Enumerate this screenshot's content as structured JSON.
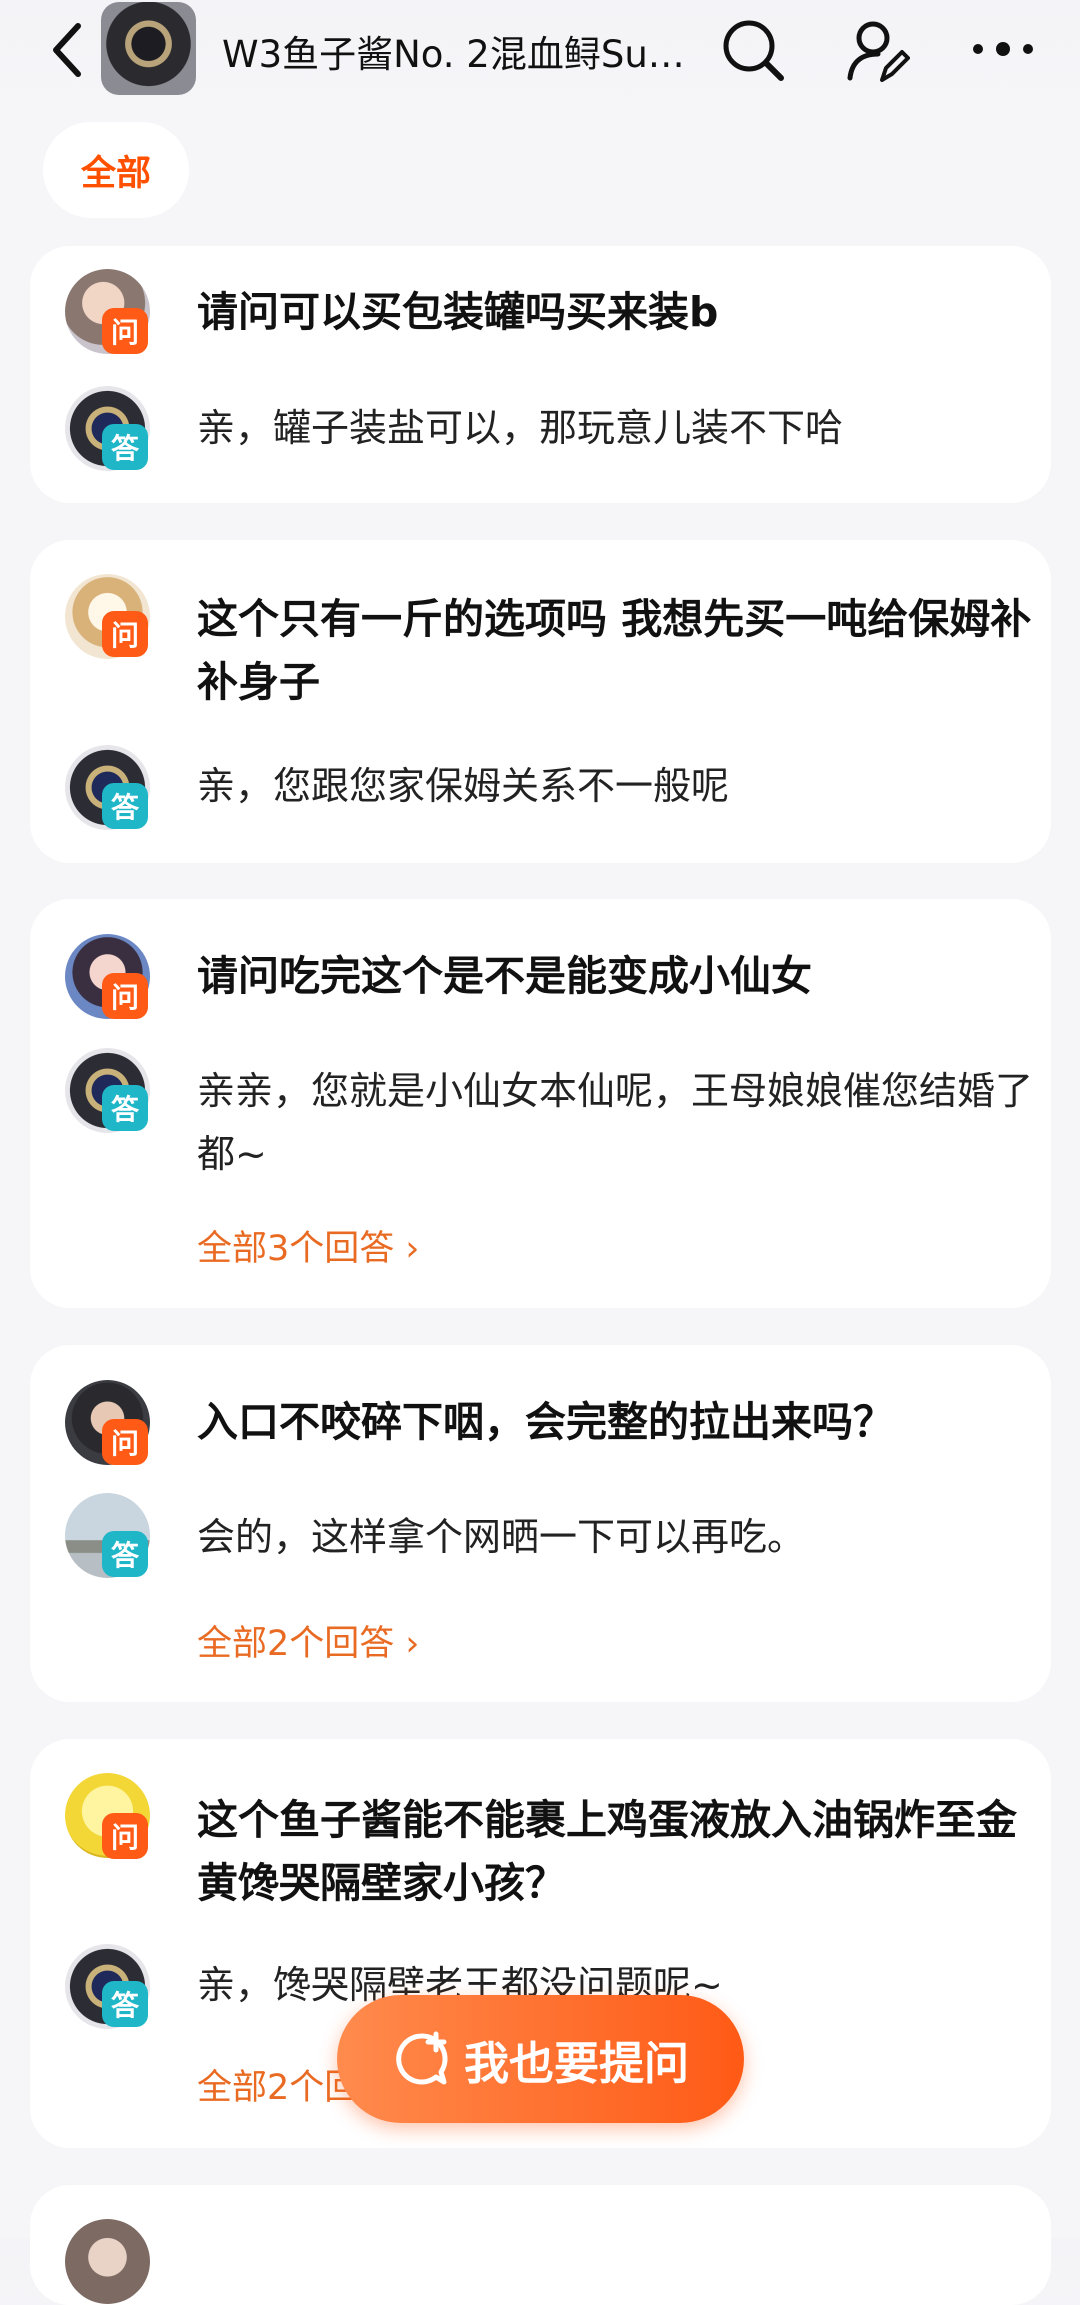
{
  "header": {
    "title": "W3鱼子酱No. 2混血鲟Sup…",
    "icons": [
      "back-icon",
      "search-icon",
      "user-edit-icon",
      "more-icon"
    ]
  },
  "filter": {
    "label": "全部"
  },
  "qa": [
    {
      "question": "请问可以买包装罐吗买来装b",
      "answer": "亲，罐子装盐可以，那玩意儿装不下哈",
      "more": ""
    },
    {
      "question": "这个只有一斤的选项吗 我想先买一吨给保姆补补身子",
      "answer": "亲，您跟您家保姆关系不一般呢",
      "more": ""
    },
    {
      "question": "请问吃完这个是不是能变成小仙女",
      "answer": "亲亲，您就是小仙女本仙呢，王母娘娘催您结婚了都~",
      "more": "全部3个回答"
    },
    {
      "question": "入口不咬碎下咽，会完整的拉出来吗？",
      "answer": "会的，这样拿个网晒一下可以再吃。",
      "more": "全部2个回答"
    },
    {
      "question": "这个鱼子酱能不能裹上鸡蛋液放入油锅炸至金黄馋哭隔壁家小孩？",
      "answer": "亲，馋哭隔壁老王都没问题呢~",
      "more": "全部2个回答"
    }
  ],
  "badges": {
    "question": "问",
    "answer": "答"
  },
  "ask_button": {
    "label": "我也要提问"
  },
  "colors": {
    "accent": "#ff5000",
    "question_badge": "#ff5a16",
    "answer_badge": "#1fb6c8",
    "link": "#e96b23"
  }
}
